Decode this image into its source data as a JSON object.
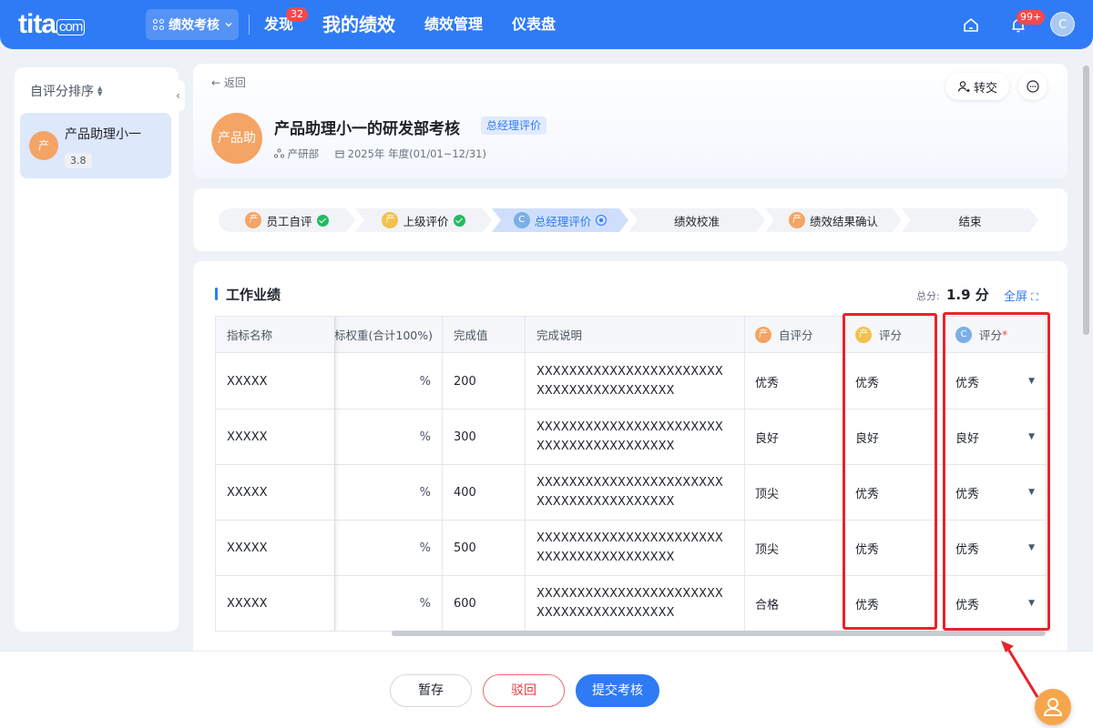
{
  "topnav": {
    "logo": "tita",
    "logo_suffix": "com",
    "app_switch": "绩效考核",
    "items": [
      {
        "label": "发现",
        "badge": "32"
      },
      {
        "label": "我的绩效"
      },
      {
        "label": "绩效管理"
      },
      {
        "label": "仪表盘"
      }
    ],
    "notify_badge": "99+",
    "avatar": "C"
  },
  "sidebar": {
    "sort_label": "自评分排序",
    "person": {
      "avatar": "产",
      "name": "产品助理小一",
      "score": "3.8"
    }
  },
  "header": {
    "back": "返回",
    "avatar": "产品助",
    "title": "产品助理小一的研发部考核",
    "tag": "总经理评价",
    "dept": "产研部",
    "period": "2025年 年度(01/01~12/31)",
    "transfer": "转交"
  },
  "steps": [
    {
      "avatar": "产",
      "label": "员工自评",
      "status": "done"
    },
    {
      "avatar": "产",
      "label": "上级评价",
      "status": "done"
    },
    {
      "avatar": "C",
      "label": "总经理评价",
      "status": "current"
    },
    {
      "label": "绩效校准"
    },
    {
      "avatar": "产",
      "label": "绩效结果确认"
    },
    {
      "label": "结束"
    }
  ],
  "section": {
    "title": "工作业绩",
    "total_label": "总分:",
    "total_value": "1.9 分",
    "fullscreen": "全屏"
  },
  "table": {
    "headers": {
      "name": "指标名称",
      "weight": "标权重(合计100%)",
      "done": "完成值",
      "desc": "完成说明",
      "self_avatar": "产",
      "self": "自评分",
      "mgr_avatar": "产",
      "mgr": "评分",
      "gm_avatar": "C",
      "gm": "评分",
      "gm_required": "*"
    },
    "rows": [
      {
        "name": "XXXXX",
        "weight": "%",
        "done": "200",
        "desc1": "XXXXXXXXXXXXXXXXXXXXXXX",
        "desc2": "XXXXXXXXXXXXXXXXX",
        "self": "优秀",
        "mgr": "优秀",
        "gm": "优秀"
      },
      {
        "name": "XXXXX",
        "weight": "%",
        "done": "300",
        "desc1": "XXXXXXXXXXXXXXXXXXXXXXX",
        "desc2": "XXXXXXXXXXXXXXXXX",
        "self": "良好",
        "mgr": "良好",
        "gm": "良好"
      },
      {
        "name": "XXXXX",
        "weight": "%",
        "done": "400",
        "desc1": "XXXXXXXXXXXXXXXXXXXXXXX",
        "desc2": "XXXXXXXXXXXXXXXXX",
        "self": "顶尖",
        "mgr": "优秀",
        "gm": "优秀"
      },
      {
        "name": "XXXXX",
        "weight": "%",
        "done": "500",
        "desc1": "XXXXXXXXXXXXXXXXXXXXXXX",
        "desc2": "XXXXXXXXXXXXXXXXX",
        "self": "顶尖",
        "mgr": "优秀",
        "gm": "优秀"
      },
      {
        "name": "XXXXX",
        "weight": "%",
        "done": "600",
        "desc1": "XXXXXXXXXXXXXXXXXXXXXXX",
        "desc2": "XXXXXXXXXXXXXXXXX",
        "self": "合格",
        "mgr": "优秀",
        "gm": "优秀"
      }
    ]
  },
  "actions": {
    "save": "暂存",
    "reject": "驳回",
    "submit": "提交考核"
  },
  "colors": {
    "primary": "#2f7bf5",
    "orange_avatar": "#f4a464",
    "yellow_avatar": "#f2c14e",
    "blue_avatar": "#7ab0e6",
    "highlight": "#e8232a",
    "done": "#25b864"
  },
  "icons": [
    "grid-icon",
    "chevron-down-icon",
    "home-icon",
    "bell-icon",
    "sort-icon",
    "collapse-icon",
    "back-arrow-icon",
    "org-icon",
    "calendar-icon",
    "user-transfer-icon",
    "chat-icon",
    "check-icon",
    "current-dot-icon",
    "fullscreen-icon",
    "caret-down-icon",
    "help-icon",
    "annotation-arrow"
  ]
}
